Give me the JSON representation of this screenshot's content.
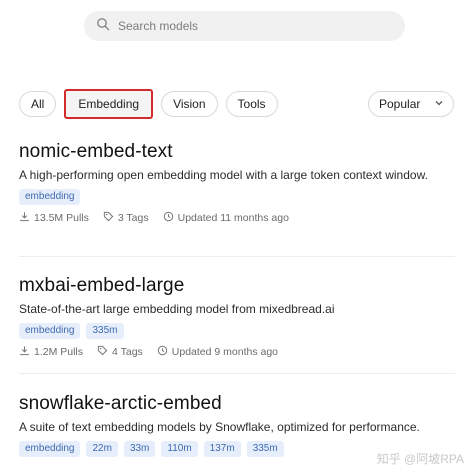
{
  "search": {
    "placeholder": "Search models"
  },
  "filters": [
    {
      "label": "All",
      "active": false
    },
    {
      "label": "Embedding",
      "active": true
    },
    {
      "label": "Vision",
      "active": false
    },
    {
      "label": "Tools",
      "active": false
    }
  ],
  "sort": {
    "selected": "Popular"
  },
  "models": [
    {
      "name": "nomic-embed-text",
      "description": "A high-performing open embedding model with a large token context window.",
      "tags": [
        "embedding"
      ],
      "pulls": "13.5M Pulls",
      "tag_count": "3 Tags",
      "updated": "Updated 11 months ago"
    },
    {
      "name": "mxbai-embed-large",
      "description": "State-of-the-art large embedding model from mixedbread.ai",
      "tags": [
        "embedding",
        "335m"
      ],
      "pulls": "1.2M Pulls",
      "tag_count": "4 Tags",
      "updated": "Updated 9 months ago"
    },
    {
      "name": "snowflake-arctic-embed",
      "description": "A suite of text embedding models by Snowflake, optimized for performance.",
      "tags": [
        "embedding",
        "22m",
        "33m",
        "110m",
        "137m",
        "335m"
      ]
    }
  ],
  "watermark": "知乎 @阿坡RPA",
  "colors": {
    "active_outline": "#d22b2b",
    "tag_bg": "#e6eefb",
    "tag_text": "#3f6ab0"
  }
}
